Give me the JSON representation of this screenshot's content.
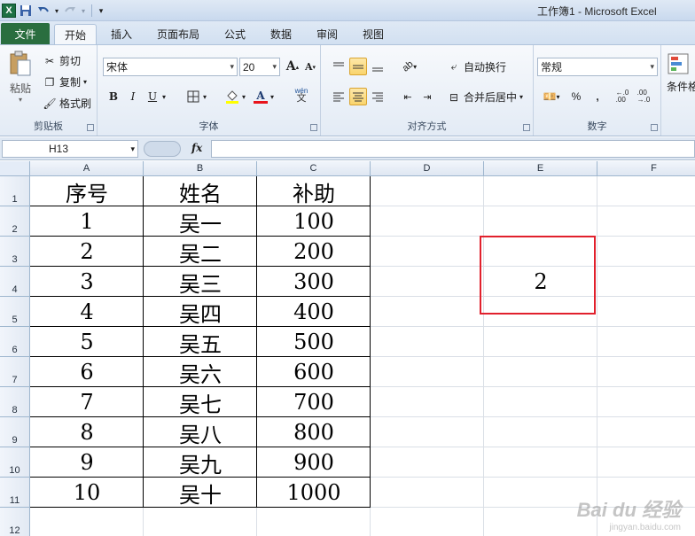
{
  "window": {
    "title": "工作簿1 - Microsoft Excel",
    "quick_access": [
      "excel-logo",
      "save-icon",
      "undo-icon",
      "redo-icon",
      "customize-icon"
    ],
    "logo_text": "X"
  },
  "tabs": {
    "file": "文件",
    "items": [
      "开始",
      "插入",
      "页面布局",
      "公式",
      "数据",
      "审阅",
      "视图"
    ],
    "active_index": 0
  },
  "ribbon": {
    "clipboard": {
      "paste": "粘贴",
      "cut": "剪切",
      "copy": "复制",
      "format_painter": "格式刷",
      "label": "剪贴板"
    },
    "font": {
      "font_name": "宋体",
      "font_size": "20",
      "grow": "A",
      "shrink": "A",
      "bold": "B",
      "italic": "I",
      "underline": "U",
      "phonetic": "wén",
      "label": "字体"
    },
    "alignment": {
      "wrap_text": "自动换行",
      "merge_center": "合并后居中",
      "label": "对齐方式"
    },
    "number": {
      "format": "常规",
      "percent": "%",
      "comma": ",",
      "label": "数字"
    },
    "styles": {
      "conditional": "条件格"
    }
  },
  "formula_bar": {
    "name_box": "H13",
    "fx": "fx",
    "formula": ""
  },
  "sheet": {
    "columns": [
      "A",
      "B",
      "C",
      "D",
      "E",
      "F"
    ],
    "rows": [
      "1",
      "2",
      "3",
      "4",
      "5",
      "6",
      "7",
      "8",
      "9",
      "10",
      "11",
      "12"
    ],
    "header": [
      "序号",
      "姓名",
      "补助"
    ],
    "data": [
      [
        "1",
        "吴一",
        "100"
      ],
      [
        "2",
        "吴二",
        "200"
      ],
      [
        "3",
        "吴三",
        "300"
      ],
      [
        "4",
        "吴四",
        "400"
      ],
      [
        "5",
        "吴五",
        "500"
      ],
      [
        "6",
        "吴六",
        "600"
      ],
      [
        "7",
        "吴七",
        "700"
      ],
      [
        "8",
        "吴八",
        "800"
      ],
      [
        "9",
        "吴九",
        "900"
      ],
      [
        "10",
        "吴十",
        "1000"
      ]
    ],
    "result_cell_value": "2",
    "highlight_color": "#e1202c"
  },
  "watermark": {
    "brand": "Bai du 经验",
    "url": "jingyan.baidu.com"
  }
}
